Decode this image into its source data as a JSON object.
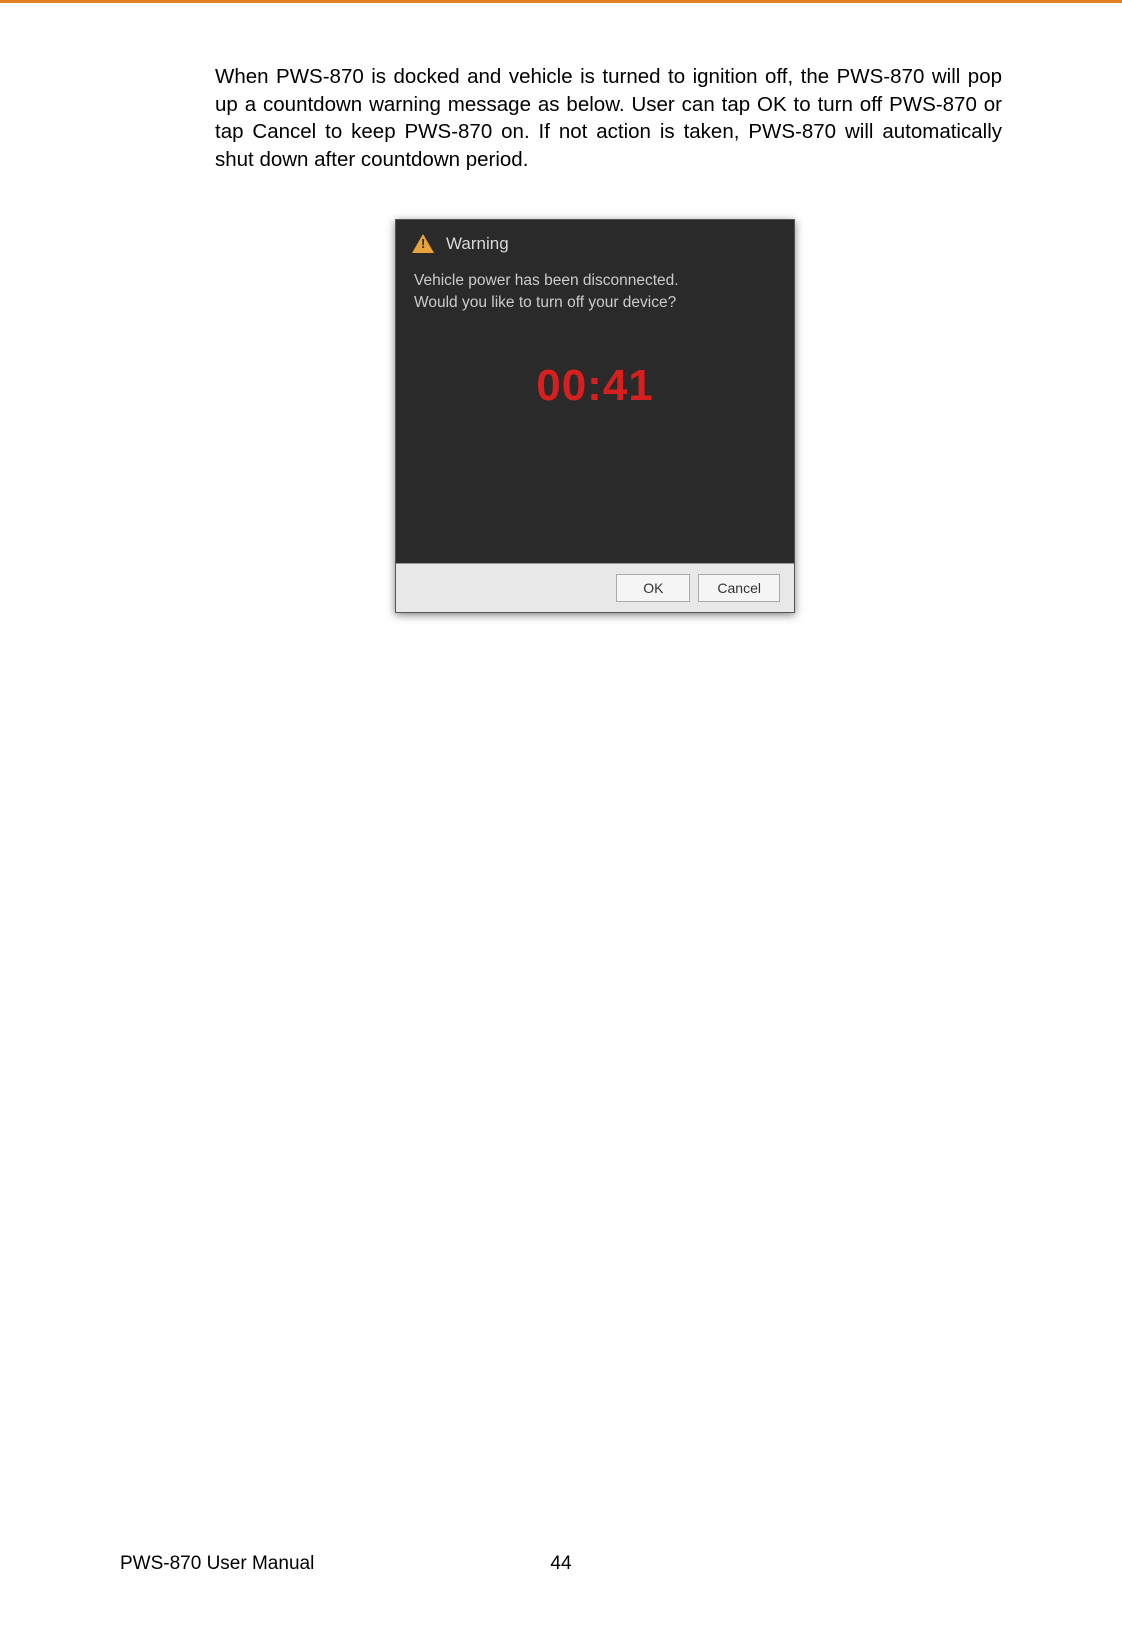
{
  "document": {
    "body_text": "When PWS-870 is docked and vehicle is turned to ignition off, the PWS-870 will pop up a countdown warning message as below. User can tap OK to turn off PWS-870 or tap Cancel to keep PWS-870 on. If not action is taken, PWS-870 will automatically shut down after countdown period."
  },
  "dialog": {
    "title": "Warning",
    "message_line1": "Vehicle power has been disconnected.",
    "message_line2": "Would you like to turn off your device?",
    "countdown": "00:41",
    "ok_label": "OK",
    "cancel_label": "Cancel"
  },
  "footer": {
    "manual_title": "PWS-870 User Manual",
    "page_number": "44"
  }
}
